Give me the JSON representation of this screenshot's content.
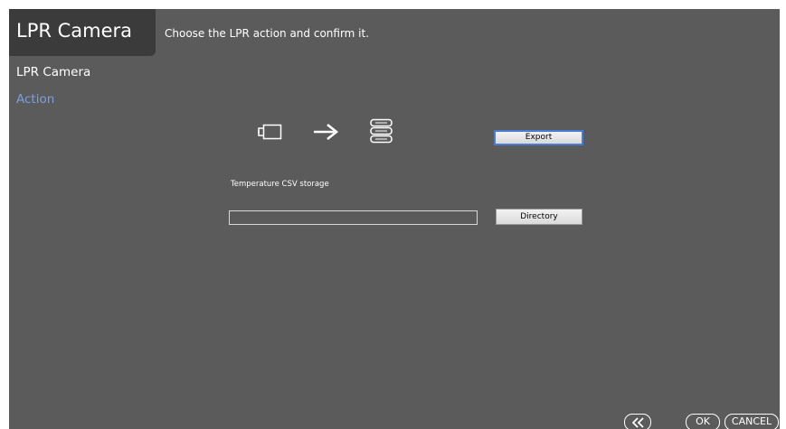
{
  "header": {
    "app_title": "LPR Camera",
    "instruction": "Choose the LPR action and confirm it."
  },
  "sidebar": {
    "items": [
      {
        "label": "LPR Camera",
        "active": false
      },
      {
        "label": "Action",
        "active": true
      }
    ]
  },
  "flow_icons": [
    "camera-icon",
    "arrow-right-icon",
    "server-icon"
  ],
  "actions": {
    "export_label": "Export",
    "directory_label": "Directory"
  },
  "storage": {
    "label": "Temperature CSV storage",
    "path_value": ""
  },
  "footer": {
    "back_icon": "double-chevron-left-icon",
    "ok_label": "OK",
    "cancel_label": "CANCEL"
  },
  "colors": {
    "background": "#5b5b5b",
    "title_box": "#3b3b3b",
    "active_item": "#7aa0dc",
    "focus_border": "#4a7cd3"
  }
}
